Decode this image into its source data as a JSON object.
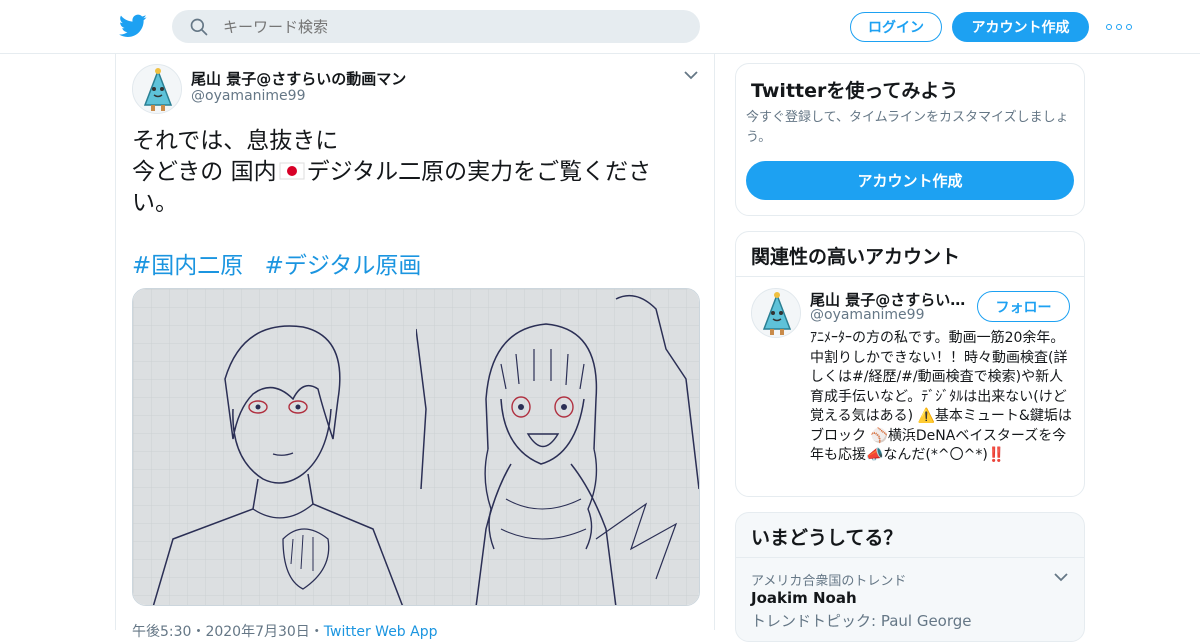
{
  "brand": {
    "accent": "#1da1f2",
    "link": "#1b95e0",
    "muted": "#657786"
  },
  "header": {
    "logo_icon": "twitter-bird-icon",
    "search_placeholder": "キーワード検索",
    "login_label": "ログイン",
    "signup_label": "アカウント作成",
    "more_icon": "more-dots-icon"
  },
  "tweet": {
    "author_name": "尾山 景子@さすらいの動画マン",
    "author_handle": "@oyamanime99",
    "text_line1": "それでは、息抜きに",
    "text_line2_pre": "今どきの 国内",
    "text_line2_post": "デジタル二原の実力をご覧くださ",
    "text_line3": "い。",
    "flag_icon": "japan-flag-icon",
    "hashtags": [
      "#国内二原",
      "#デジタル原画"
    ],
    "media_alt": [
      "男性キャラクターの二原",
      "女性キャラクターの二原"
    ],
    "meta_time": "午後5:30・2020年7月30日・",
    "meta_source": "Twitter Web App"
  },
  "sidebar": {
    "try": {
      "title": "Twitterを使ってみよう",
      "desc": "今すぐ登録して、タイムラインをカスタマイズしましょう。",
      "cta": "アカウント作成"
    },
    "related": {
      "title": "関連性の高いアカウント",
      "name": "尾山 景子@さすらいの動画マン",
      "handle": "@oyamanime99",
      "follow_label": "フォロー",
      "bio": "ｱﾆﾒｰﾀｰの方の私です。動画一筋20余年。中割りしかできない！！時々動画検査(詳しくは#/経歴/#/動画検査で検索)や新人育成手伝いなど。ﾃﾞｼﾞﾀﾙは出来ない(けど覚える気はある) ⚠️基本ミュート&鍵垢はブロック ⚾横浜DeNAベイスターズを今年も応援📣なんだ(*^〇^*)‼️"
    },
    "trends": {
      "title": "いまどうしてる？",
      "context": "アメリカ合衆国のトレンド",
      "name": "Joakim Noah",
      "topic": "トレンドトピック: Paul George"
    }
  }
}
